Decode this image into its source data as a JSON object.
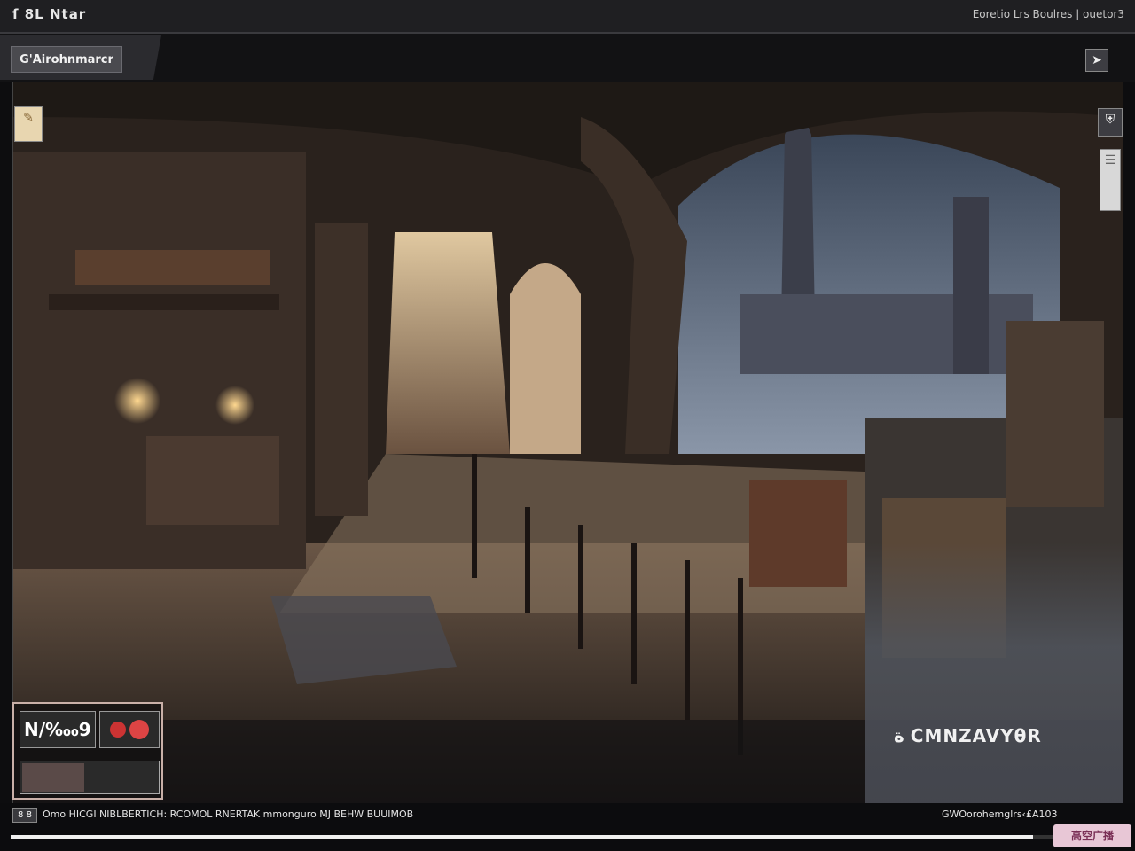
{
  "topbar": {
    "left_title": "ſ 8L Ntаr",
    "right_text": "Eoretio Lrs Boulres | ouetor3"
  },
  "tab": {
    "label": "G'Airohnmarcr"
  },
  "icons": {
    "top_right": "chevron-icon",
    "left_badge": "scroll-icon",
    "right_badge": "shield-icon",
    "right_card": "card-icon"
  },
  "hud": {
    "nq_label": "N/‱9",
    "right_label": "ة CMNZAVYθR"
  },
  "bottom": {
    "left_badge": "8 8",
    "status_text": "Omo HICGI NIBLBERTICH: RCOMOL RNERTAK mmonguro MJ BEHW BUUIMOB",
    "right_text": "GWOοrohemglrs‹₤A103",
    "progress": 0.93,
    "corner": "高空广播"
  },
  "colors": {
    "accent": "#c9b0a8",
    "panel": "#2b2b2f",
    "bg": "#0d0d0f"
  }
}
